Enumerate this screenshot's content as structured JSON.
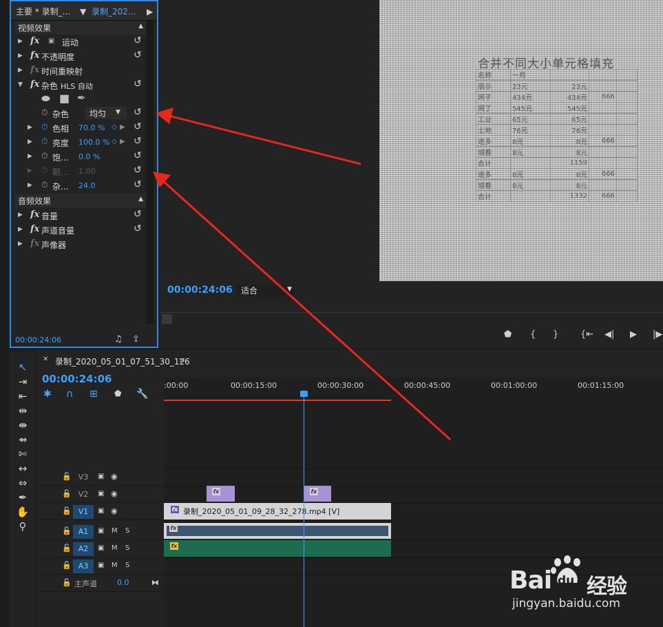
{
  "effect_controls": {
    "tab_main": "主要 * 录制_...",
    "tab_selected": "录制_202...",
    "video_section": "视频效果",
    "audio_section": "音频效果",
    "rows": {
      "motion": "运动",
      "opacity": "不透明度",
      "time_remap": "时间重映射",
      "noise_hls": "杂色",
      "noise_hls_sub": "HLS 自动",
      "noise": "杂色",
      "noise_value": "均匀",
      "hue": "色相",
      "hue_value": "70.0 %",
      "lightness": "亮度",
      "lightness_value": "100.0 %",
      "saturation": "饱...",
      "saturation_value": "0.0 %",
      "grain": "颗...",
      "grain_value": "1.00",
      "noise_phase": "杂...",
      "noise_phase_value": "24.0",
      "volume": "音量",
      "channel_volume": "声道音量",
      "panner": "声像器"
    },
    "timecode": "00:00:24:06"
  },
  "program_monitor": {
    "timecode": "00:00:24:06",
    "fit_label": "适合",
    "frame_title": "合并不同大小单元格填充",
    "table": [
      [
        "名称",
        "一月",
        "",
        "",
        ""
      ],
      [
        "辰示",
        "23元",
        "23元",
        "",
        ""
      ],
      [
        "网子",
        "434元",
        "434元",
        "666",
        ""
      ],
      [
        "网了",
        "545元",
        "545元",
        "",
        ""
      ],
      [
        "工业",
        "65元",
        "65元",
        "",
        ""
      ],
      [
        "土地",
        "76元",
        "76元",
        "",
        ""
      ],
      [
        "途多",
        "8元",
        "8元",
        "666",
        ""
      ],
      [
        "城看",
        "8元",
        "8元",
        "",
        ""
      ],
      [
        "合计",
        "",
        "1159",
        "",
        ""
      ],
      [
        "途多",
        "8元",
        "8元",
        "666",
        ""
      ],
      [
        "城看",
        "8元",
        "8元",
        "",
        ""
      ],
      [
        "合计",
        "",
        "1332",
        "666",
        ""
      ]
    ]
  },
  "timeline": {
    "sequence_name": "录制_2020_05_01_07_51_30_126",
    "timecode": "00:00:24:06",
    "ruler_labels": [
      ":00:00",
      "00:00:15:00",
      "00:00:30:00",
      "00:00:45:00",
      "00:01:00:00",
      "00:01:15:00"
    ],
    "tracks": {
      "v3": "V3",
      "v2": "V2",
      "v1": "V1",
      "a1": "A1",
      "a2": "A2",
      "a3": "A3",
      "master": "主声道",
      "master_value": "0.0",
      "m": "M",
      "s": "S"
    },
    "v1_clip": "录制_2020_05_01_09_28_32_278.mp4 [V]",
    "fx": "fx"
  },
  "watermark": {
    "brand_left": "Bai",
    "brand_right": "经验",
    "brand_du": "du",
    "url": "jingyan.baidu.com"
  },
  "colors": {
    "accent": "#3aa0ff",
    "arrow": "#e8281c",
    "adjustment_clip": "#a892d6",
    "v1_clip": "#d4d4d4",
    "a1_clip": "#3e5572",
    "a2_clip": "#1d6b50"
  }
}
